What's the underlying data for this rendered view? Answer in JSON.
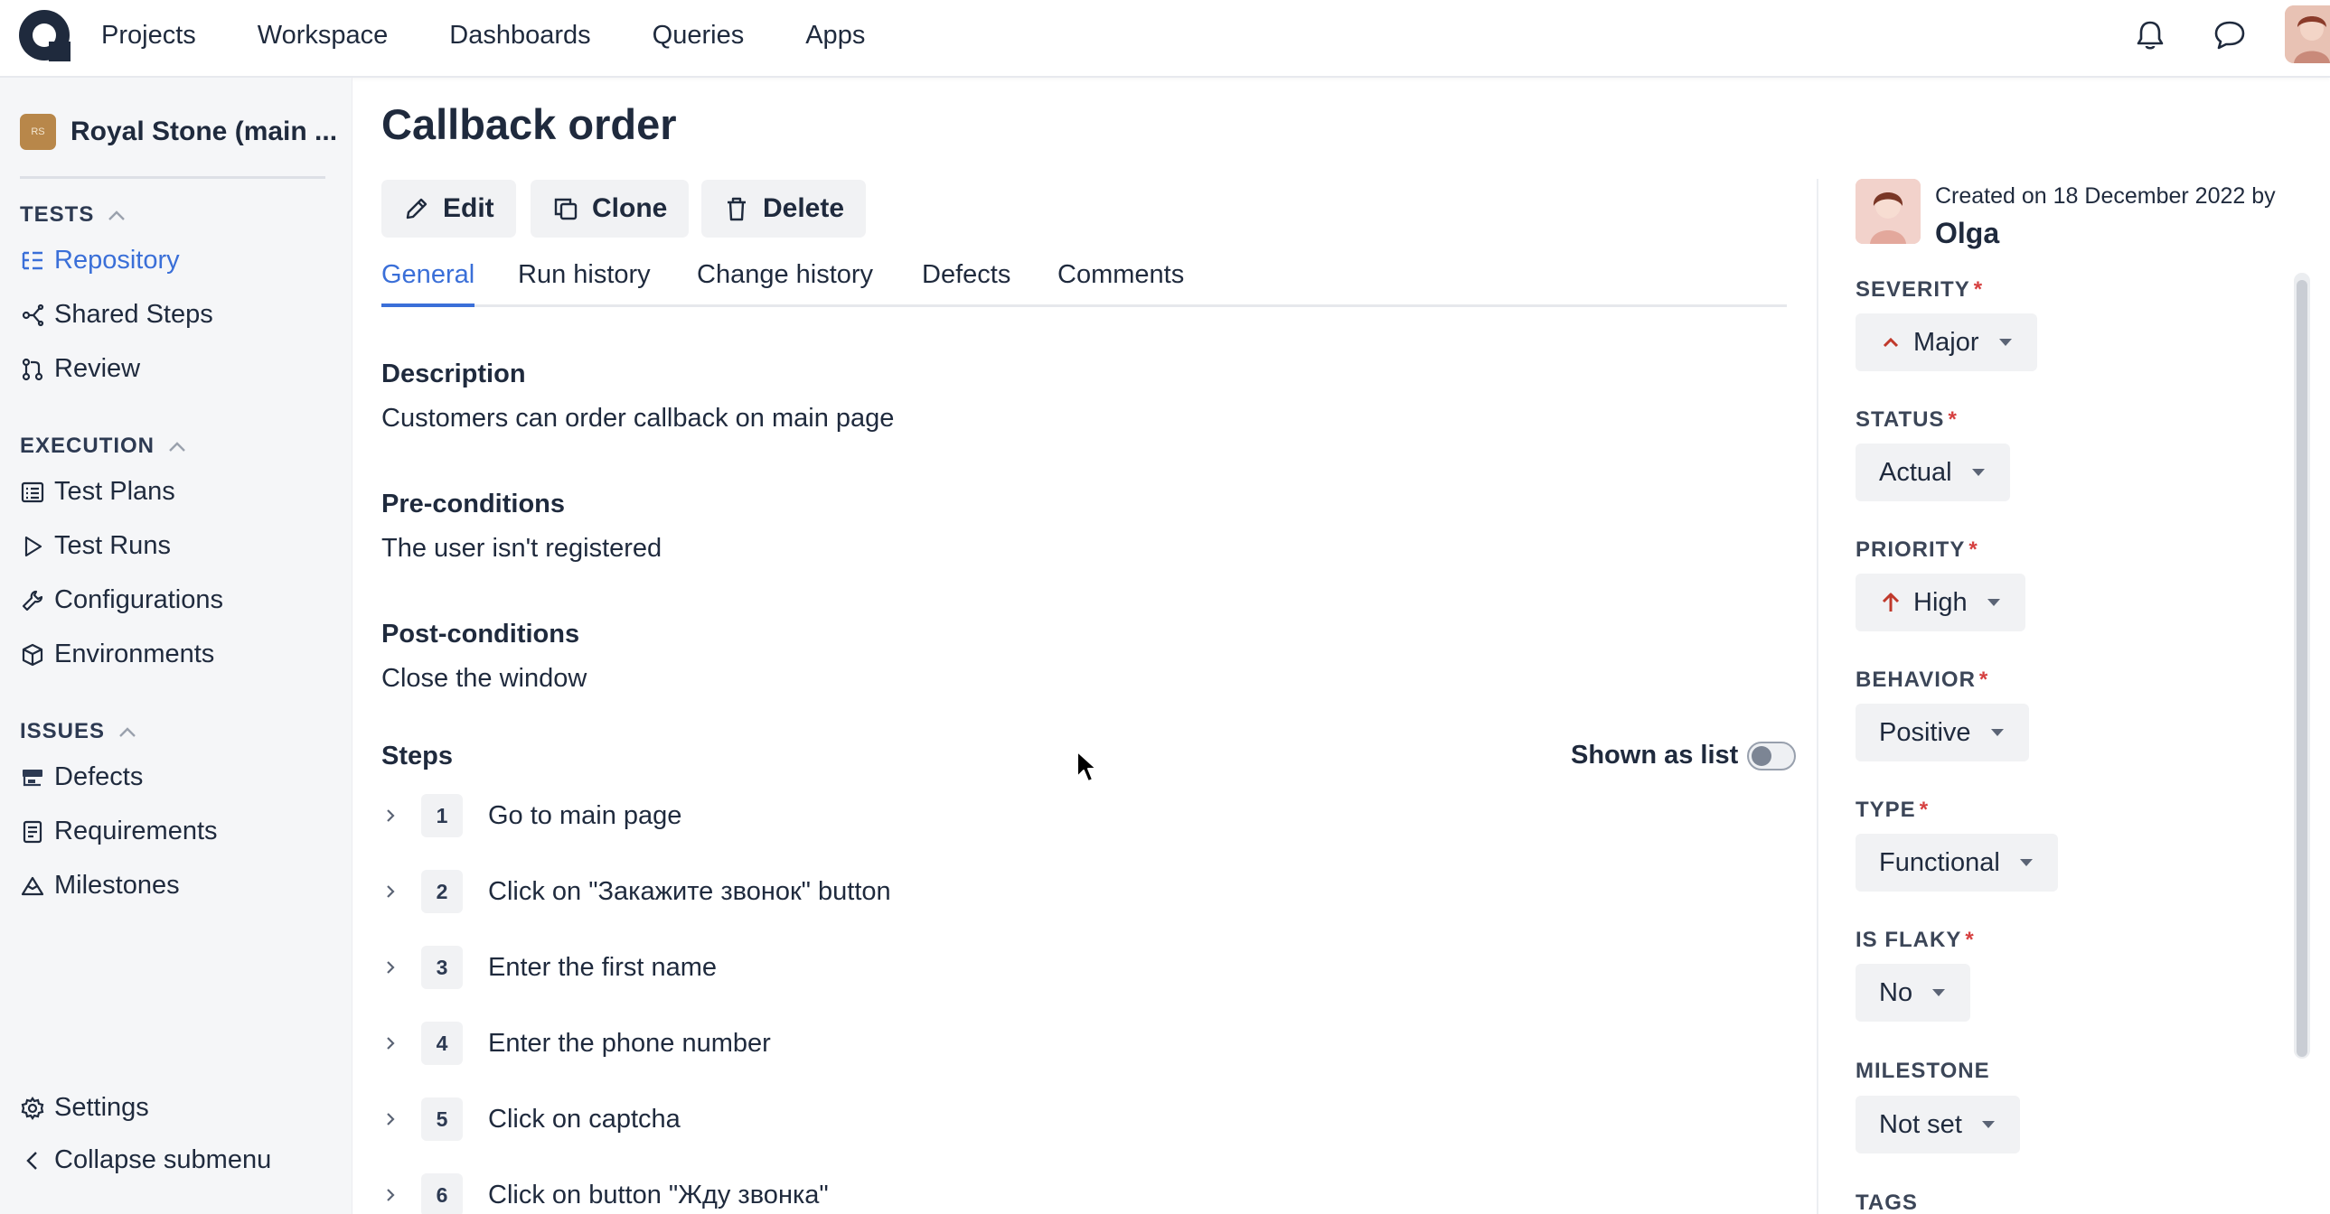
{
  "nav": {
    "items": [
      "Projects",
      "Workspace",
      "Dashboards",
      "Queries",
      "Apps"
    ]
  },
  "sidebar": {
    "project_badge": "RS",
    "project_name": "Royal Stone (main ...",
    "tests_header": "TESTS",
    "tests_items": [
      "Repository",
      "Shared Steps",
      "Review"
    ],
    "execution_header": "EXECUTION",
    "execution_items": [
      "Test Plans",
      "Test Runs",
      "Configurations",
      "Environments"
    ],
    "issues_header": "ISSUES",
    "issues_items": [
      "Defects",
      "Requirements",
      "Milestones"
    ],
    "settings": "Settings",
    "collapse": "Collapse submenu"
  },
  "page": {
    "title": "Callback order",
    "actions": {
      "edit": "Edit",
      "clone": "Clone",
      "delete": "Delete"
    },
    "tabs": [
      "General",
      "Run history",
      "Change history",
      "Defects",
      "Comments"
    ],
    "description_label": "Description",
    "description": "Customers can order callback on main page",
    "preconditions_label": "Pre-conditions",
    "preconditions": "The user isn't registered",
    "postconditions_label": "Post-conditions",
    "postconditions": "Close the window",
    "steps_label": "Steps",
    "shown_as_list": "Shown as list",
    "steps": [
      {
        "num": "1",
        "text": "Go to main page"
      },
      {
        "num": "2",
        "text": "Click on \"Закажите звонок\" button"
      },
      {
        "num": "3",
        "text": "Enter the first name"
      },
      {
        "num": "4",
        "text": "Enter the phone number"
      },
      {
        "num": "5",
        "text": "Click on captcha"
      },
      {
        "num": "6",
        "text": "Click on button \"Жду звонка\""
      }
    ]
  },
  "details": {
    "created_line": "Created on 18 December 2022 by",
    "creator": "Olga",
    "required_mark": "*",
    "severity_label": "SEVERITY",
    "severity": "Major",
    "status_label": "STATUS",
    "status": "Actual",
    "priority_label": "PRIORITY",
    "priority": "High",
    "behavior_label": "BEHAVIOR",
    "behavior": "Positive",
    "type_label": "TYPE",
    "type": "Functional",
    "flaky_label": "IS FLAKY",
    "flaky": "No",
    "milestone_label": "MILESTONE",
    "milestone": "Not set",
    "tags_label": "TAGS"
  },
  "colors": {
    "accent": "#3a6fd8",
    "required": "#d64040",
    "priority_up": "#c0392b"
  }
}
